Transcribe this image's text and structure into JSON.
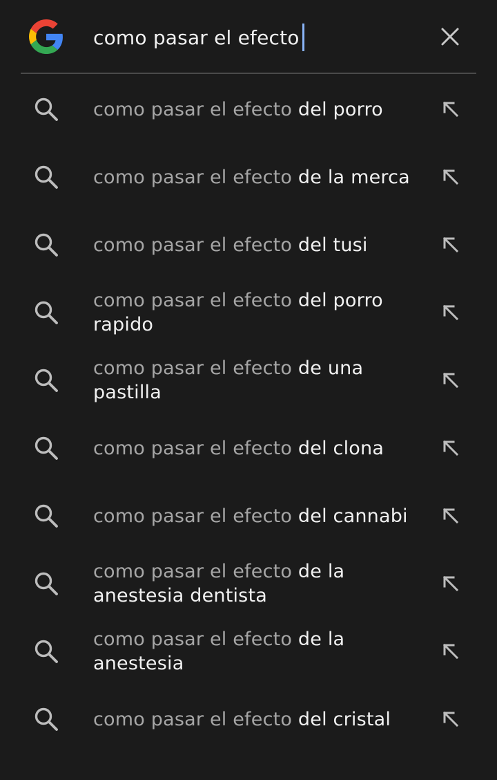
{
  "search": {
    "query": "como pasar el efecto",
    "clear_icon": "close-icon",
    "logo": "google-g-logo"
  },
  "colors": {
    "background": "#1b1b1b",
    "caret": "#8ab4f8",
    "prefix_text": "#a6a6a6",
    "suffix_text": "#f1f1f1"
  },
  "suggestions": [
    {
      "prefix": "como pasar el efecto",
      "suffix": "del porro"
    },
    {
      "prefix": "como pasar el efecto",
      "suffix": "de la merca"
    },
    {
      "prefix": "como pasar el efecto",
      "suffix": "del tusi"
    },
    {
      "prefix": "como pasar el efecto",
      "suffix": "del porro rapido"
    },
    {
      "prefix": "como pasar el efecto",
      "suffix": "de una pastilla"
    },
    {
      "prefix": "como pasar el efecto",
      "suffix": "del clona"
    },
    {
      "prefix": "como pasar el efecto",
      "suffix": "del cannabi"
    },
    {
      "prefix": "como pasar el efecto",
      "suffix": "de la anestesia dentista"
    },
    {
      "prefix": "como pasar el efecto",
      "suffix": "de la anestesia"
    },
    {
      "prefix": "como pasar el efecto",
      "suffix": "del cristal"
    }
  ]
}
